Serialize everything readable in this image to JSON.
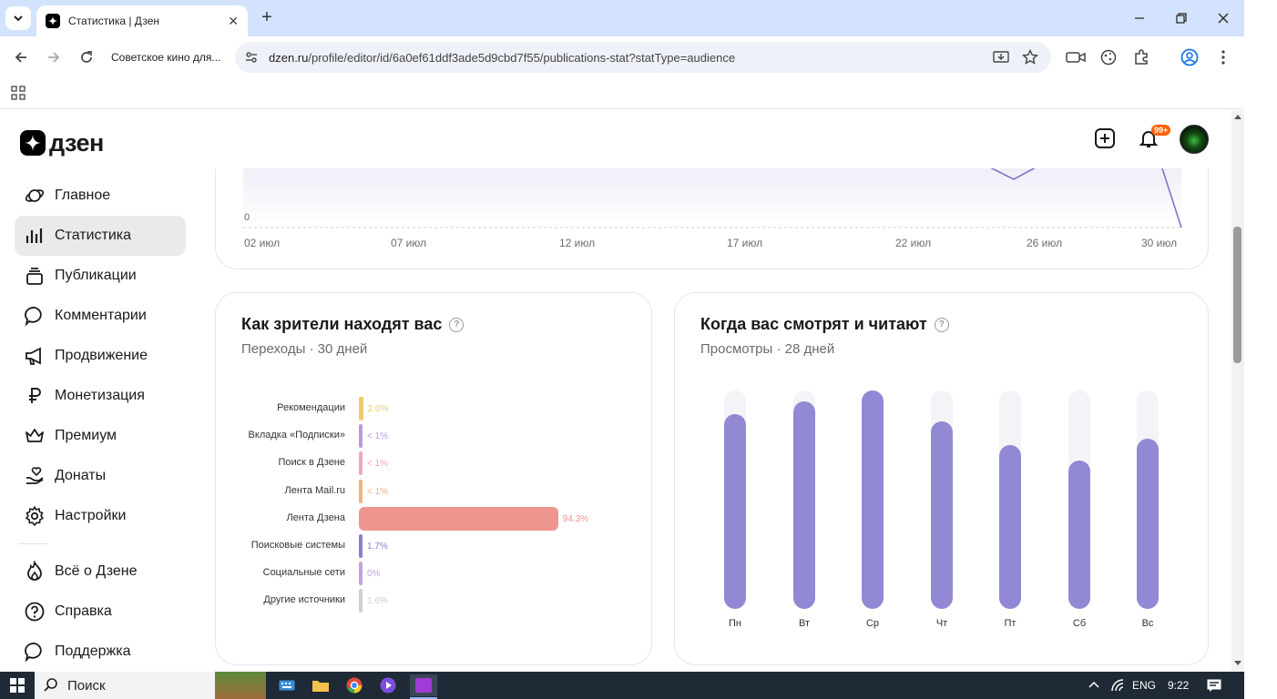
{
  "browser": {
    "tab_title": "Статистика | Дзен",
    "profile_label": "Советское кино для...",
    "url_host": "dzen.ru",
    "url_path": "/profile/editor/id/6a0ef61ddf3ade5d9cbd7f55/publications-stat?statType=audience"
  },
  "header": {
    "logo_text": "дзен",
    "notifications_badge": "99+"
  },
  "sidebar": {
    "items": [
      {
        "label": "Главное",
        "icon": "planet-icon"
      },
      {
        "label": "Статистика",
        "icon": "bar-chart-icon"
      },
      {
        "label": "Публикации",
        "icon": "stack-icon"
      },
      {
        "label": "Комментарии",
        "icon": "comment-icon"
      },
      {
        "label": "Продвижение",
        "icon": "megaphone-icon"
      },
      {
        "label": "Монетизация",
        "icon": "ruble-icon"
      },
      {
        "label": "Премиум",
        "icon": "crown-icon"
      },
      {
        "label": "Донаты",
        "icon": "donate-hand-icon"
      },
      {
        "label": "Настройки",
        "icon": "gear-icon"
      }
    ],
    "bottom_items": [
      {
        "label": "Всё о Дзене",
        "icon": "flame-icon"
      },
      {
        "label": "Справка",
        "icon": "question-icon"
      },
      {
        "label": "Поддержка",
        "icon": "chat-icon"
      }
    ]
  },
  "trend_chart": {
    "zero_label": "0",
    "x_ticks": [
      "02 июл",
      "07 июл",
      "12 июл",
      "17 июл",
      "22 июл",
      "26 июл",
      "30 июл"
    ]
  },
  "sources_card": {
    "title": "Как зрители находят вас",
    "subtitle": "Переходы · 30 дней"
  },
  "when_card": {
    "title": "Когда вас смотрят и читают",
    "subtitle": "Просмотры · 28 дней"
  },
  "chart_data": [
    {
      "type": "bar",
      "orientation": "horizontal",
      "title": "Как зрители находят вас",
      "subtitle": "Переходы · 30 дней",
      "categories": [
        "Рекомендации",
        "Вкладка «Подписки»",
        "Поиск в Дзене",
        "Лента Mail.ru",
        "Лента Дзена",
        "Поисковые системы",
        "Социальные сети",
        "Другие источники"
      ],
      "values": [
        2.0,
        0.5,
        0.5,
        0.5,
        94.3,
        1.7,
        0,
        1.6
      ],
      "value_labels": [
        "2.0%",
        "< 1%",
        "< 1%",
        "< 1%",
        "94.3%",
        "1.7%",
        "0%",
        "1.6%"
      ],
      "colors": [
        "#f7c96b",
        "#b79be0",
        "#f2a3c4",
        "#f5b27a",
        "#ef9590",
        "#8b7fd1",
        "#c7a2df",
        "#cfcfcf"
      ],
      "xlim": [
        0,
        100
      ]
    },
    {
      "type": "bar",
      "title": "Когда вас смотрят и читают",
      "subtitle": "Просмотры · 28 дней",
      "categories": [
        "Пн",
        "Вт",
        "Ср",
        "Чт",
        "Пт",
        "Сб",
        "Вс"
      ],
      "values": [
        0.89,
        0.95,
        1.0,
        0.86,
        0.75,
        0.68,
        0.78
      ],
      "ylim": [
        0,
        1
      ],
      "color": "#9189d4"
    }
  ],
  "taskbar": {
    "search_label": "Поиск",
    "lang": "ENG",
    "time": "9:22"
  }
}
